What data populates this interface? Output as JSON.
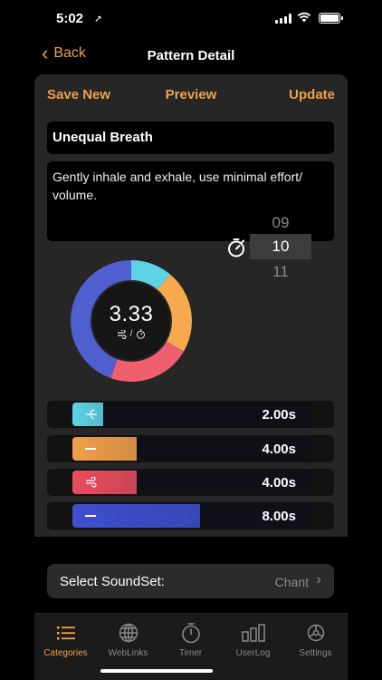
{
  "status_bar": {
    "time": "5:02",
    "location_icon": "location-arrow-icon"
  },
  "nav": {
    "back_label": "Back",
    "title": "Pattern Detail"
  },
  "actions": {
    "save_new": "Save New",
    "preview": "Preview",
    "update": "Update"
  },
  "pattern": {
    "name": "Unequal Breath",
    "description": "Gently inhale and exhale, use minimal effort/ volume."
  },
  "ratio": {
    "value": "3.33",
    "separator": "/"
  },
  "picker": {
    "prev": "09",
    "selected": "10",
    "next": "11"
  },
  "donut_segments": [
    {
      "name": "inhale",
      "fraction": 0.111,
      "color": "#5fd3e6"
    },
    {
      "name": "hold-in",
      "fraction": 0.222,
      "color": "#f6a94f"
    },
    {
      "name": "exhale",
      "fraction": 0.222,
      "color": "#ef5f6e"
    },
    {
      "name": "hold-out",
      "fraction": 0.445,
      "color": "#4f5fd0"
    }
  ],
  "phases": [
    {
      "name": "inhale",
      "duration": "2.00s",
      "fill_fraction": 0.13,
      "color": "#5fd3e6",
      "icon": "inhale-icon"
    },
    {
      "name": "hold-in",
      "duration": "4.00s",
      "fill_fraction": 0.27,
      "color": "#f0a04a",
      "icon": "hold-icon"
    },
    {
      "name": "exhale",
      "duration": "4.00s",
      "fill_fraction": 0.27,
      "color": "#e84d5e",
      "icon": "exhale-wind-icon"
    },
    {
      "name": "hold-out",
      "duration": "8.00s",
      "fill_fraction": 0.54,
      "color": "#3f4fcf",
      "icon": "hold-icon"
    }
  ],
  "soundset": {
    "label": "Select SoundSet:",
    "value": "Chant"
  },
  "tabs": [
    {
      "label": "Categories",
      "icon": "list-icon",
      "active": true
    },
    {
      "label": "WebLinks",
      "icon": "globe-icon",
      "active": false
    },
    {
      "label": "Timer",
      "icon": "stopwatch-icon",
      "active": false
    },
    {
      "label": "UserLog",
      "icon": "bar-chart-icon",
      "active": false
    },
    {
      "label": "Settings",
      "icon": "gear-icon",
      "active": false
    }
  ]
}
